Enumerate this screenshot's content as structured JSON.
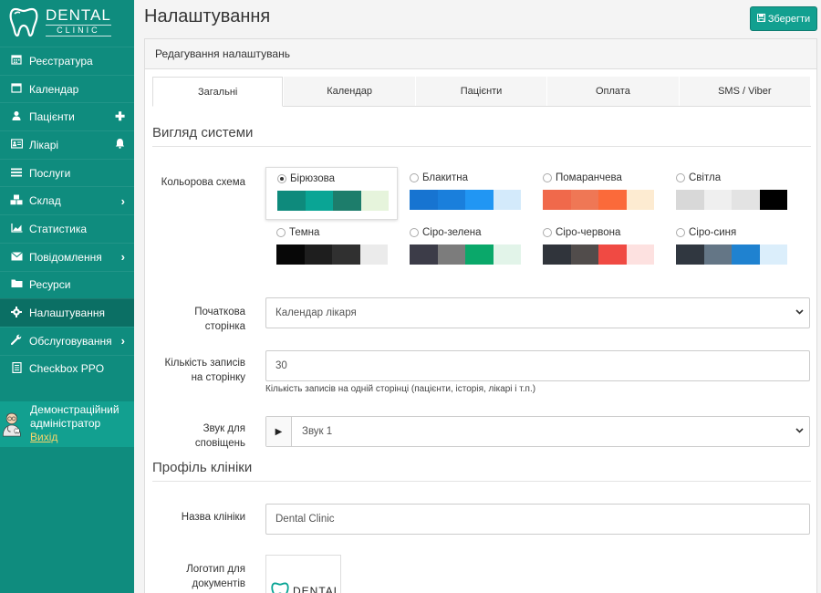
{
  "brand": {
    "name": "DENTAL",
    "sub": "CLINIC"
  },
  "sidebar": {
    "items": [
      {
        "label": "Реєстратура",
        "icon": "calendar-grid-icon"
      },
      {
        "label": "Календар",
        "icon": "calendar-icon"
      },
      {
        "label": "Пацієнти",
        "icon": "user-icon",
        "right": "+"
      },
      {
        "label": "Лікарі",
        "icon": "id-card-icon",
        "right": "bell"
      },
      {
        "label": "Послуги",
        "icon": "list-icon"
      },
      {
        "label": "Склад",
        "icon": "cubes-icon",
        "right": ">"
      },
      {
        "label": "Статистика",
        "icon": "chart-icon"
      },
      {
        "label": "Повідомлення",
        "icon": "envelope-icon",
        "right": ">"
      },
      {
        "label": "Ресурси",
        "icon": "folder-icon"
      },
      {
        "label": "Налаштування",
        "icon": "gear-icon",
        "active": true
      },
      {
        "label": "Обслуговування",
        "icon": "wrench-icon",
        "right": ">"
      },
      {
        "label": "Checkbox PPO",
        "icon": "document-icon"
      }
    ],
    "user": {
      "name": "Демонстраційний адміністратор",
      "logout": "Вихід"
    }
  },
  "header": {
    "title": "Налаштування",
    "save_label": "Зберегти"
  },
  "panel": {
    "title": "Редагування налаштувань"
  },
  "tabs": [
    "Загальні",
    "Календар",
    "Пацієнти",
    "Оплата",
    "SMS / Viber"
  ],
  "sections": {
    "appearance": "Вигляд системи",
    "clinic_profile": "Профіль клініки"
  },
  "labels": {
    "color_scheme": "Кольорова схема",
    "start_page": "Початкова сторінка",
    "records_per_page": "Кількість записів на сторінку",
    "notification_sound": "Звук для сповіщень",
    "clinic_name": "Назва клініки",
    "logo": "Логотип для документів"
  },
  "color_schemes": [
    {
      "name": "Бірюзова",
      "selected": true,
      "colors": [
        "#0e8a7c",
        "#0aa595",
        "#1d7d6b",
        "#e6f4dc"
      ]
    },
    {
      "name": "Блакитна",
      "colors": [
        "#1774d1",
        "#1a7fdc",
        "#2196f3",
        "#d3eafb"
      ]
    },
    {
      "name": "Помаранчева",
      "colors": [
        "#f0694b",
        "#ef7755",
        "#fb6a3a",
        "#fdebd1"
      ]
    },
    {
      "name": "Світла",
      "colors": [
        "#d8d8d8",
        "#efefef",
        "#e3e3e3",
        "#000000"
      ]
    },
    {
      "name": "Темна",
      "colors": [
        "#070707",
        "#1e1e1e",
        "#303030",
        "#ebebeb"
      ]
    },
    {
      "name": "Сіро-зелена",
      "colors": [
        "#3c3c48",
        "#7c7c7c",
        "#0aa86a",
        "#e2f4e9"
      ]
    },
    {
      "name": "Сіро-червона",
      "colors": [
        "#30343b",
        "#514c4b",
        "#f04a43",
        "#fde1e0"
      ]
    },
    {
      "name": "Сіро-синя",
      "colors": [
        "#303740",
        "#647686",
        "#1f82d0",
        "#dbeefb"
      ]
    }
  ],
  "fields": {
    "start_page_value": "Календар лікаря",
    "records_value": "30",
    "records_help": "Кількість записів на одній сторінці (пацієнти, історія, лікарі і т.п.)",
    "sound_value": "Звук 1",
    "clinic_name_value": "Dental Clinic",
    "logo_text": "DENTAL"
  }
}
